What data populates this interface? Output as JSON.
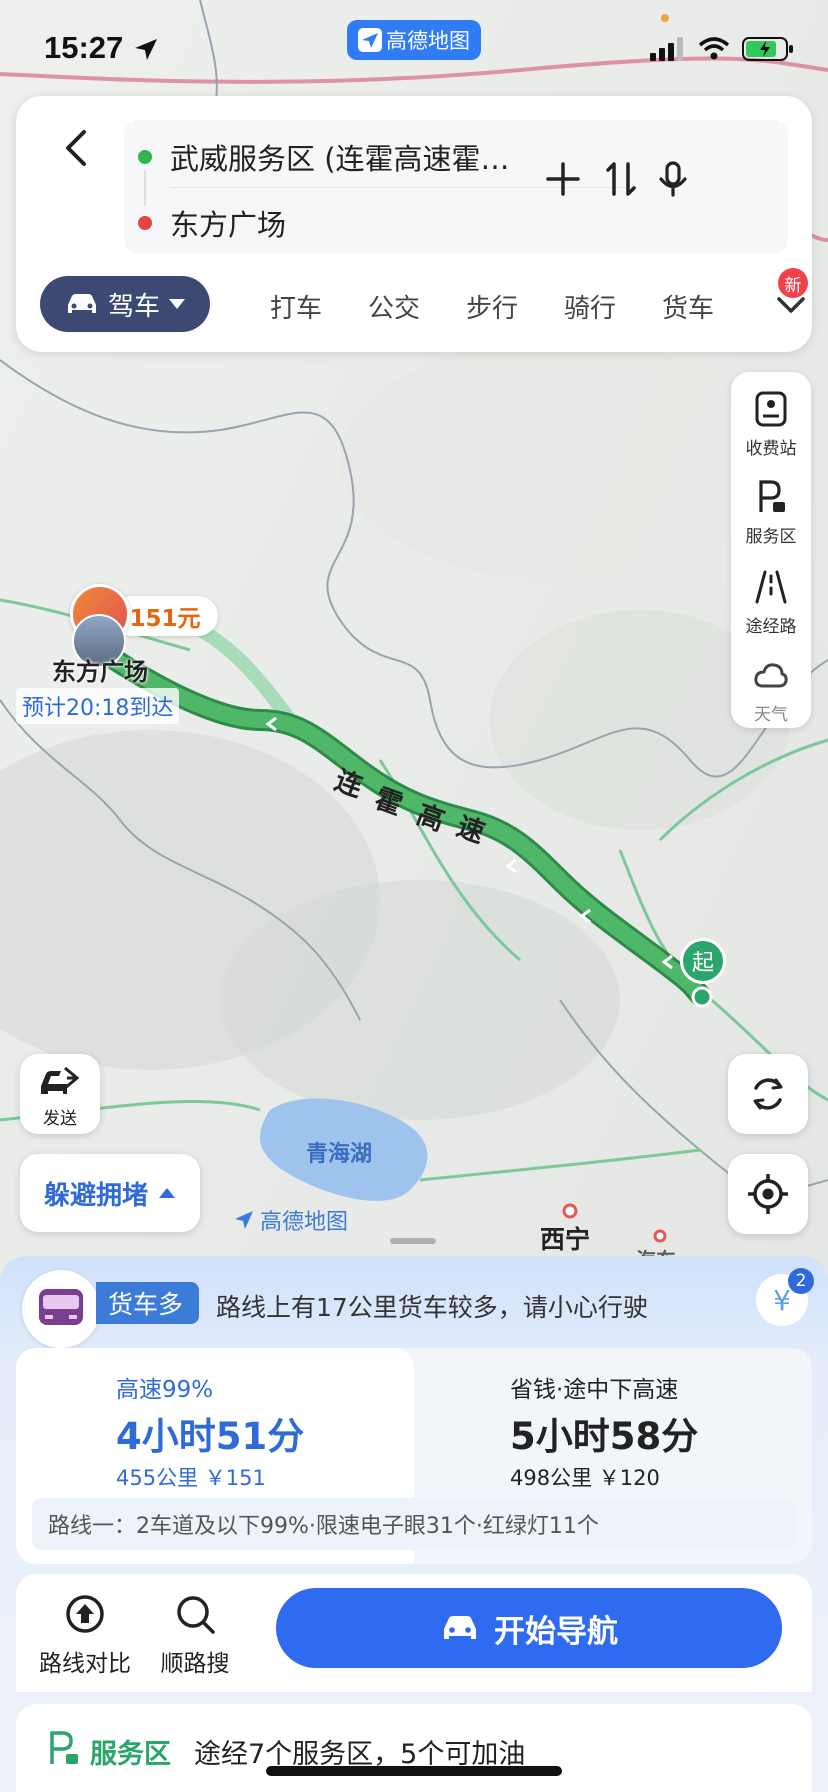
{
  "status_bar": {
    "time": "15:27",
    "app_badge": "高德地图"
  },
  "route_input": {
    "origin": "武威服务区 (连霍高速霍…",
    "destination": "东方广场"
  },
  "modes": {
    "active": "驾车",
    "items": [
      "打车",
      "公交",
      "步行",
      "骑行",
      "货车"
    ],
    "new_badge": "新"
  },
  "right_panel": {
    "items": [
      {
        "label": "收费站",
        "icon": "toll-station-icon"
      },
      {
        "label": "服务区",
        "icon": "service-area-icon"
      },
      {
        "label": "途经路",
        "icon": "via-road-icon"
      },
      {
        "label": "天气",
        "icon": "weather-icon"
      }
    ]
  },
  "map": {
    "price_tag": "151元",
    "destination_label": "东方广场",
    "eta": "预计20:18到达",
    "road_name": [
      "连",
      "霍",
      "高",
      "速"
    ],
    "start_pin": "起",
    "lake": "青海湖",
    "watermark": "高德地图",
    "city": "西宁",
    "city2": "海东"
  },
  "floating": {
    "send_label": "发送",
    "avoid_label": "躲避拥堵"
  },
  "sheet": {
    "truck_tag": "货车多",
    "truck_msg": "路线上有17公里货车较多，请小心行驶",
    "yen_count": "2",
    "route_a": {
      "tag": "高速99%",
      "time": "4小时51分",
      "meta": "455公里 ￥151"
    },
    "route_b": {
      "tag": "省钱·途中下高速",
      "time": "5小时58分",
      "meta": "498公里 ￥120"
    },
    "route_detail": "路线一：2车道及以下99%·限速电子眼31个·红绿灯11个",
    "actions": {
      "compare": "路线对比",
      "search_along": "顺路搜",
      "navigate": "开始导航"
    },
    "service": {
      "title": "服务区",
      "text": "途经7个服务区，5个可加油"
    }
  },
  "colors": {
    "accent": "#2f6bf0",
    "route_green": "#3fa860",
    "drive_pill": "#3c4a73"
  }
}
